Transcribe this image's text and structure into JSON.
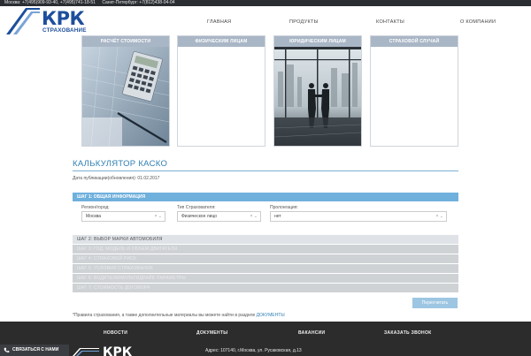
{
  "topbar": {
    "moscow": "Москва: +7(495)909-93-40, +7(495)741-18-51",
    "spb": "Санкт-Петербург: +7(812)438-04-04"
  },
  "logo": {
    "name": "КРК",
    "sub": "СТРАХОВАНИЕ"
  },
  "nav": [
    "ГЛАВНАЯ",
    "ПРОДУКТЫ",
    "КОНТАКТЫ",
    "О КОМПАНИИ"
  ],
  "cards": [
    {
      "title": "РАСЧЁТ СТОИМОСТИ"
    },
    {
      "title": "ФИЗИЧЕСКИМ ЛИЦАМ"
    },
    {
      "title": "ЮРИДИЧЕСКИМ ЛИЦАМ"
    },
    {
      "title": "СТРАХОВОЙ СЛУЧАЙ"
    }
  ],
  "calculator": {
    "title": "КАЛЬКУЛЯТОР КАСКО",
    "pubdate": "Дата публикации(обновления): 01.02.2017",
    "step1": "ШАГ 1: ОБЩАЯ ИНФОРМАЦИЯ",
    "fields": [
      {
        "label": "Регион/город:",
        "value": "Москва"
      },
      {
        "label": "Тип Страхователя:",
        "value": "Физическое лицо"
      },
      {
        "label": "Пролонгация:",
        "value": "нет"
      }
    ],
    "steps": [
      "ШАГ 2: ВЫБОР МАРКИ АВТОМОБИЛЯ",
      "ШАГ 3: ГОД, МОДЕЛЬ И ОБЪЕМ ДВИГАТЕЛЯ",
      "ШАГ 4: СТРАХОВОЙ РИСК",
      "ШАГ 5: УСЛОВИЯ СТРАХОВАНИЯ",
      "ШАГ 6: ВОДИТЕЛИ/МУЛЬТИДРАЙВ ПАРАМЕТРЫ",
      "ШАГ 7: СТОИМОСТЬ ДОГОВОРА"
    ],
    "button": "Пересчитать",
    "rules_text": "*Правила страхования, а также дополнительные материалы вы можете найти в разделе ",
    "rules_link": "ДОКУМЕНТЫ"
  },
  "footer": {
    "nav": [
      "НОВОСТИ",
      "ДОКУМЕНТЫ",
      "ВАКАНСИИ",
      "ЗАКАЗАТЬ ЗВОНОК"
    ],
    "address": "Адрес: 107140, г.Москва, ул. Русаковская, д.13",
    "logo_text": "КРК",
    "contact": "СВЯЗАТЬСЯ С НАМИ"
  },
  "colors": {
    "brand": "#1d4f9c",
    "accent": "#6fb0dc",
    "footer": "#2c2c2c"
  }
}
